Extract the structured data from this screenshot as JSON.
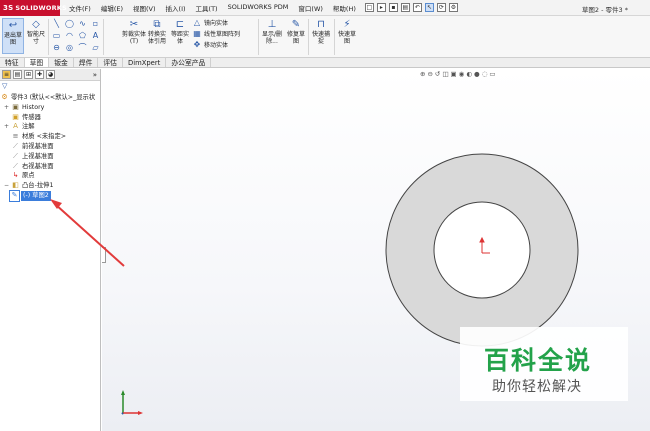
{
  "app": {
    "logo_mark": "3S",
    "logo_text": "SOLIDWORKS",
    "doc_title": "草图2 - 零件3 *"
  },
  "menu": [
    "文件(F)",
    "编辑(E)",
    "视图(V)",
    "插入(I)",
    "工具(T)",
    "SOLIDWORKS PDM",
    "窗口(W)",
    "帮助(H)"
  ],
  "ribbon": {
    "exit_sketch": "退出草图",
    "smart_dimension": "智能尺寸",
    "trim_entities": "剪裁实体(T)",
    "convert_entities": "转换实体引用",
    "offset_entities": "等距实体",
    "mirror_entities": "镜向实体",
    "linear_pattern": "线性草图阵列",
    "move_entities": "移动实体",
    "display_delete": "显示/删除...",
    "repair_sketch": "修复草图",
    "quick_snaps": "快速捕捉",
    "rapid_sketch": "快速草图"
  },
  "tabs": [
    "特征",
    "草图",
    "钣金",
    "焊件",
    "评估",
    "DimXpert",
    "办公室产品"
  ],
  "active_tab": "草图",
  "tree": {
    "root": "零件3 (默认<<默认>_显示状",
    "items": [
      {
        "label": "History",
        "icon": "history-icon"
      },
      {
        "label": "传感器",
        "icon": "sensor-icon"
      },
      {
        "label": "注解",
        "icon": "annotation-icon"
      },
      {
        "label": "材质 <未指定>",
        "icon": "material-icon"
      },
      {
        "label": "前视基准面",
        "icon": "plane-icon"
      },
      {
        "label": "上视基准面",
        "icon": "plane-icon"
      },
      {
        "label": "右视基准面",
        "icon": "plane-icon"
      },
      {
        "label": "原点",
        "icon": "origin-icon"
      },
      {
        "label": "凸台-拉伸1",
        "icon": "extrude-icon"
      }
    ],
    "selected_label": "(-) 草图2"
  },
  "watermark": {
    "title": "百科全说",
    "subtitle": "助你轻松解决"
  },
  "colors": {
    "part_fill": "#d9d9d9",
    "part_edge": "#444444",
    "arrow": "#e23b3b",
    "accent": "#3b7ddb",
    "watermark": "#23a24a"
  }
}
